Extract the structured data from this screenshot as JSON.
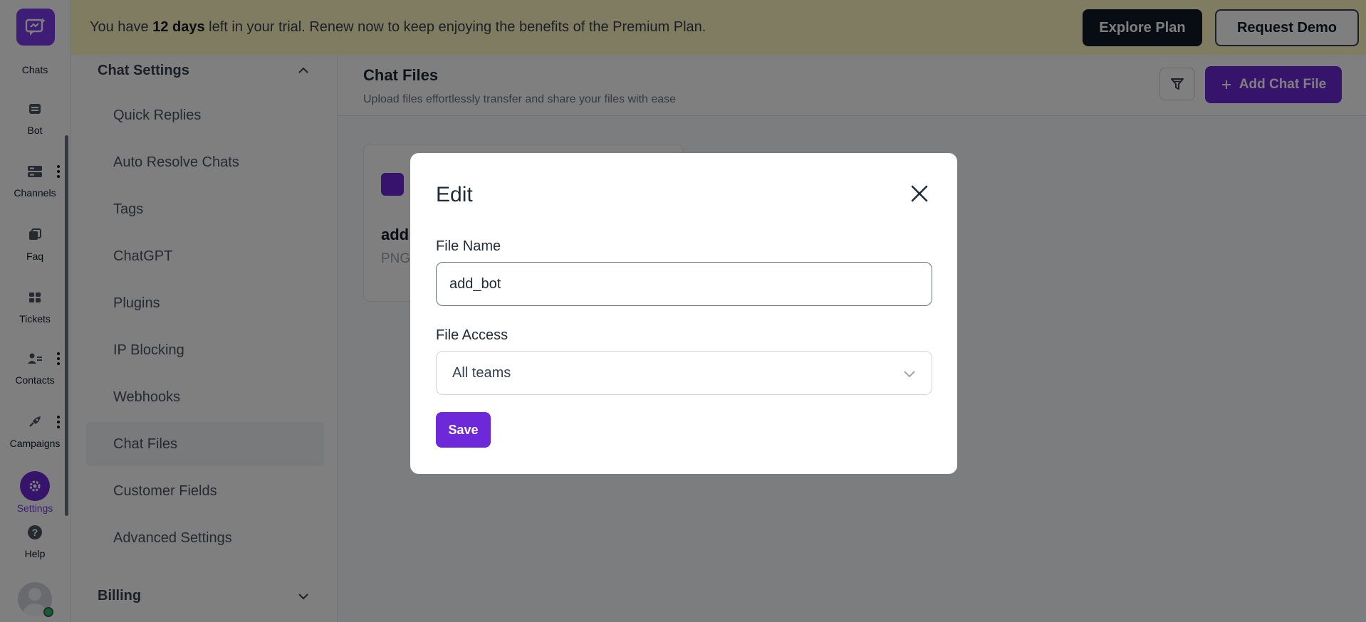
{
  "rail": {
    "items": [
      {
        "label": "Chats",
        "icon": "chats-icon"
      },
      {
        "label": "Bot",
        "icon": "bot-icon"
      },
      {
        "label": "Channels",
        "icon": "channels-icon"
      },
      {
        "label": "Faq",
        "icon": "faq-icon"
      },
      {
        "label": "Tickets",
        "icon": "tickets-icon"
      },
      {
        "label": "Contacts",
        "icon": "contacts-icon"
      },
      {
        "label": "Campaigns",
        "icon": "campaigns-icon"
      },
      {
        "label": "Settings",
        "icon": "settings-icon"
      },
      {
        "label": "Help",
        "icon": "help-icon"
      }
    ],
    "active_item": "Settings",
    "status": "online"
  },
  "banner": {
    "text_before": "You have ",
    "days": "12 days",
    "text_after": " left in your trial. Renew now to keep enjoying the benefits of the Premium Plan.",
    "explore_label": "Explore Plan",
    "demo_label": "Request Demo"
  },
  "settings": {
    "chat_section_title": "Chat Settings",
    "items": [
      "Quick Replies",
      "Auto Resolve Chats",
      "Tags",
      "ChatGPT",
      "Plugins",
      "IP Blocking",
      "Webhooks",
      "Chat Files",
      "Customer Fields",
      "Advanced Settings"
    ],
    "active_item": "Chat Files",
    "billing_section_title": "Billing"
  },
  "main": {
    "title": "Chat Files",
    "subtitle": "Upload files effortlessly transfer and share your files with ease",
    "add_label": "Add Chat File",
    "file_card": {
      "name": "add",
      "type": "PNG"
    }
  },
  "modal": {
    "title": "Edit",
    "file_name_label": "File Name",
    "file_name_value": "add_bot",
    "file_access_label": "File Access",
    "file_access_value": "All teams",
    "save_label": "Save"
  },
  "colors": {
    "brand": "#6d28d9",
    "banner_bg": "#fef9c3",
    "online": "#22c55e"
  }
}
